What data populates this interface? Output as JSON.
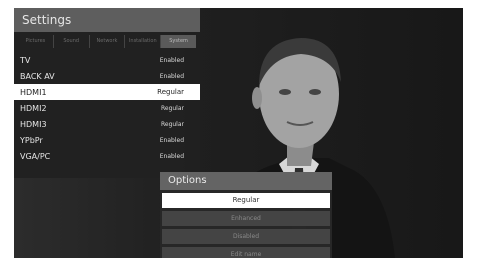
{
  "settings": {
    "title": "Settings",
    "tabs": [
      {
        "label": "Pictures"
      },
      {
        "label": "Sound"
      },
      {
        "label": "Network"
      },
      {
        "label": "Installation"
      },
      {
        "label": "System"
      }
    ],
    "items": [
      {
        "name": "TV",
        "status": "Enabled"
      },
      {
        "name": "BACK AV",
        "status": "Enabled"
      },
      {
        "name": "HDMI1",
        "status": "Regular"
      },
      {
        "name": "HDMI2",
        "status": "Regular"
      },
      {
        "name": "HDMI3",
        "status": "Regular"
      },
      {
        "name": "YPbPr",
        "status": "Enabled"
      },
      {
        "name": "VGA/PC",
        "status": "Enabled"
      }
    ]
  },
  "options": {
    "title": "Options",
    "items": [
      {
        "label": "Regular"
      },
      {
        "label": "Enhanced"
      },
      {
        "label": "Disabled"
      },
      {
        "label": "Edit name"
      }
    ]
  }
}
